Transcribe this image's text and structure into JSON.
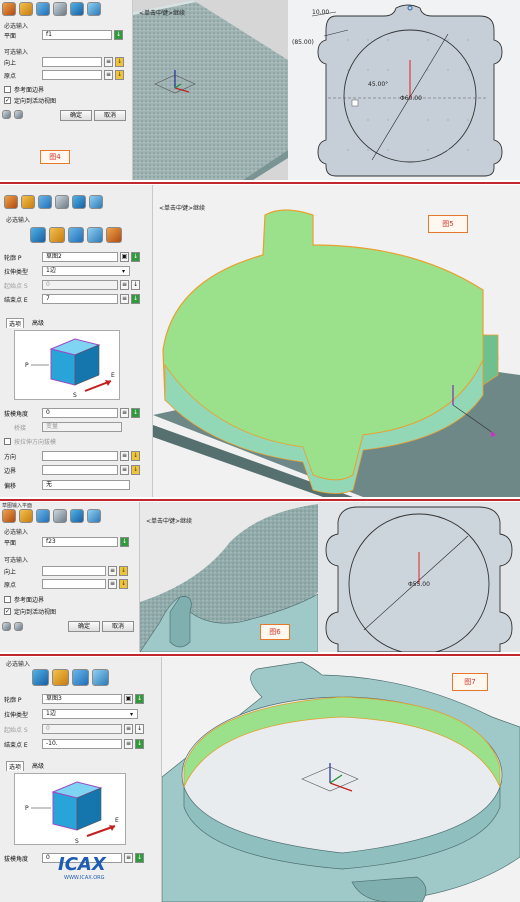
{
  "panel1": {
    "dialog": {
      "section_required": "必选输入",
      "plane_label": "平面",
      "plane_value": "f1",
      "section_optional": "可选输入",
      "up_label": "向上",
      "origin_label": "原点",
      "ref_boundary_label": "参考面边界",
      "locate_view_label": "定向到活动视图",
      "ok_label": "确定",
      "cancel_label": "取消"
    },
    "viewport_hint": "<单击中键>继续",
    "figure_tag": "图4",
    "sketch_dims": {
      "dim_10": "10.00",
      "dim_85": "(85.00)",
      "dim_45": "45.00°",
      "dim_dia": "Φ60.00"
    }
  },
  "panel2": {
    "viewport_hint": "<单击中键>继续",
    "figure_tag": "图5",
    "dialog": {
      "section_required": "必选输入",
      "profile_label": "轮廓 P",
      "profile_value": "草图2",
      "extrude_type_label": "拉伸类型",
      "extrude_type_value": "1边",
      "start_label": "起始点 S",
      "start_value": "0",
      "end_label": "结束点 E",
      "end_value": "7",
      "tab_options": "选项",
      "tab_advanced": "高级",
      "cube_p": "P",
      "cube_e": "E",
      "cube_s": "S",
      "draft_label": "拔模角度",
      "draft_value": "0",
      "bridge_label": "桥接",
      "bridge_value": "变量",
      "draft_by_dir_label": "按拉伸方向拔模",
      "dir_label": "方向",
      "bound_label": "边界",
      "offset_label": "偏移",
      "offset_value": "无"
    }
  },
  "panel3": {
    "title": "草图输入平面",
    "dialog": {
      "section_required": "必选输入",
      "plane_label": "平面",
      "plane_value": "f23",
      "section_optional": "可选输入",
      "up_label": "向上",
      "origin_label": "原点",
      "ref_boundary_label": "参考面边界",
      "locate_view_label": "定向到活动视图",
      "ok_label": "确定",
      "cancel_label": "取消"
    },
    "viewport_hint": "<单击中键>继续",
    "figure_tag": "图6",
    "sketch_dims": {
      "dim_dia": "Φ55.00"
    }
  },
  "panel4": {
    "dialog": {
      "section_required": "必选输入",
      "profile_label": "轮廓 P",
      "profile_value": "草图3",
      "extrude_type_label": "拉伸类型",
      "extrude_type_value": "1边",
      "start_label": "起始点 S",
      "start_value": "0",
      "end_label": "结束点 E",
      "end_value": "-10.",
      "tab_options": "选项",
      "tab_advanced": "高级",
      "cube_p": "P",
      "cube_e": "E",
      "cube_s": "S",
      "draft_label": "拔模角度",
      "draft_value": "0"
    },
    "figure_tag": "图7",
    "watermark": {
      "brand": "ICAX",
      "url": "WWW.ICAX.ORG"
    }
  },
  "colors": {
    "separator": "#c0282e",
    "green_face": "#9be08a",
    "solid_blue": "#9fc9c8",
    "tag_border": "#e5782a",
    "tag_text": "#d6352b"
  }
}
